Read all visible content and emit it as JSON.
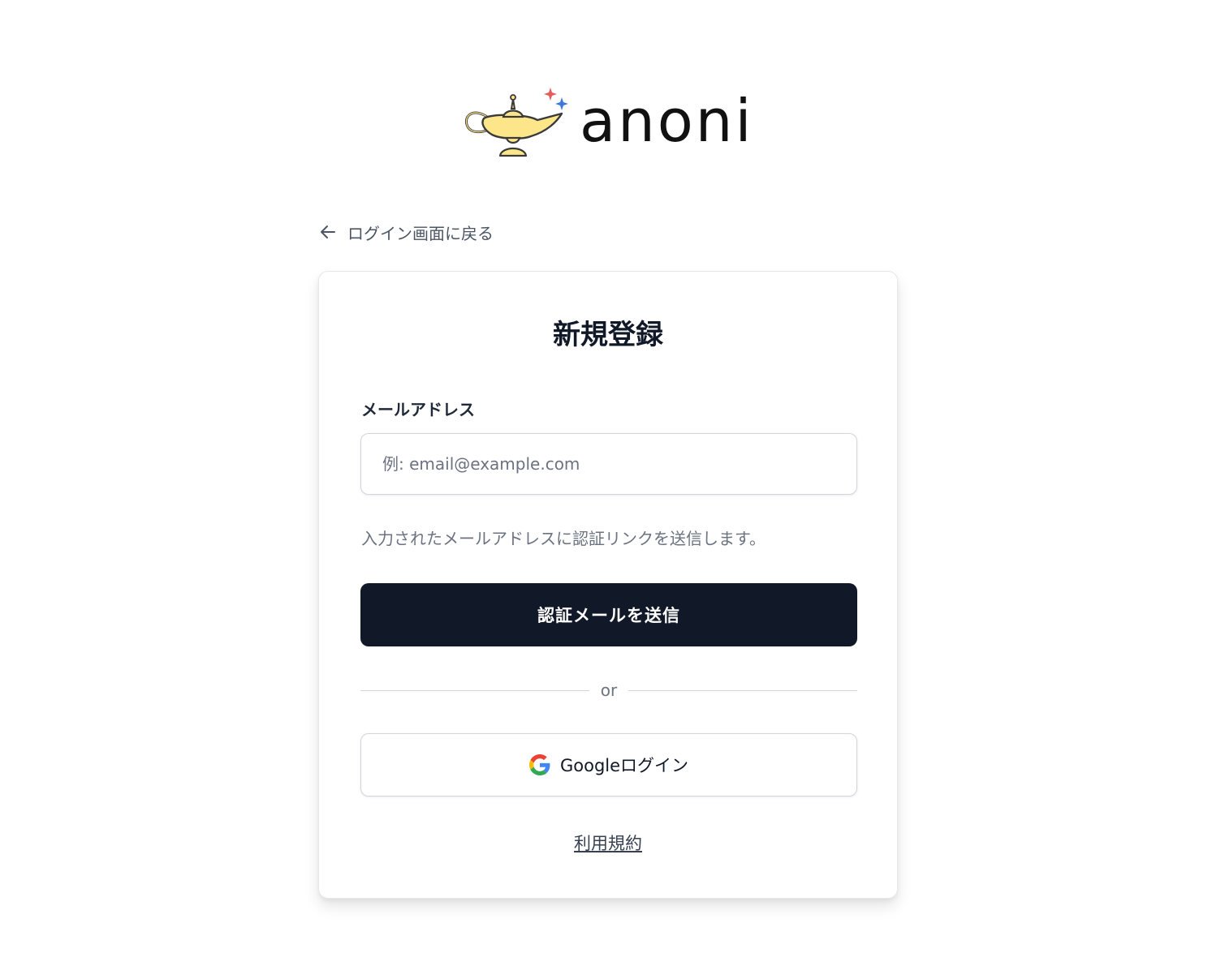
{
  "brand": {
    "name": "anoni",
    "logo_icon": "magic-lamp-icon",
    "lamp_color": "#fde68a",
    "sparkle_colors": [
      "#e35d5b",
      "#3b78d8"
    ]
  },
  "nav": {
    "back_label": "ログイン画面に戻る",
    "back_icon": "arrow-left-icon"
  },
  "form": {
    "title": "新規登録",
    "email_label": "メールアドレス",
    "email_value": "",
    "email_placeholder": "例: email@example.com",
    "helper_text": "入力されたメールアドレスに認証リンクを送信します。",
    "submit_label": "認証メールを送信",
    "divider_text": "or",
    "google_label": "Googleログイン",
    "google_icon": "google-icon",
    "terms_label": "利用規約"
  },
  "colors": {
    "primary": "#111827",
    "text_muted": "#6b7280",
    "border": "#d1d5db"
  }
}
